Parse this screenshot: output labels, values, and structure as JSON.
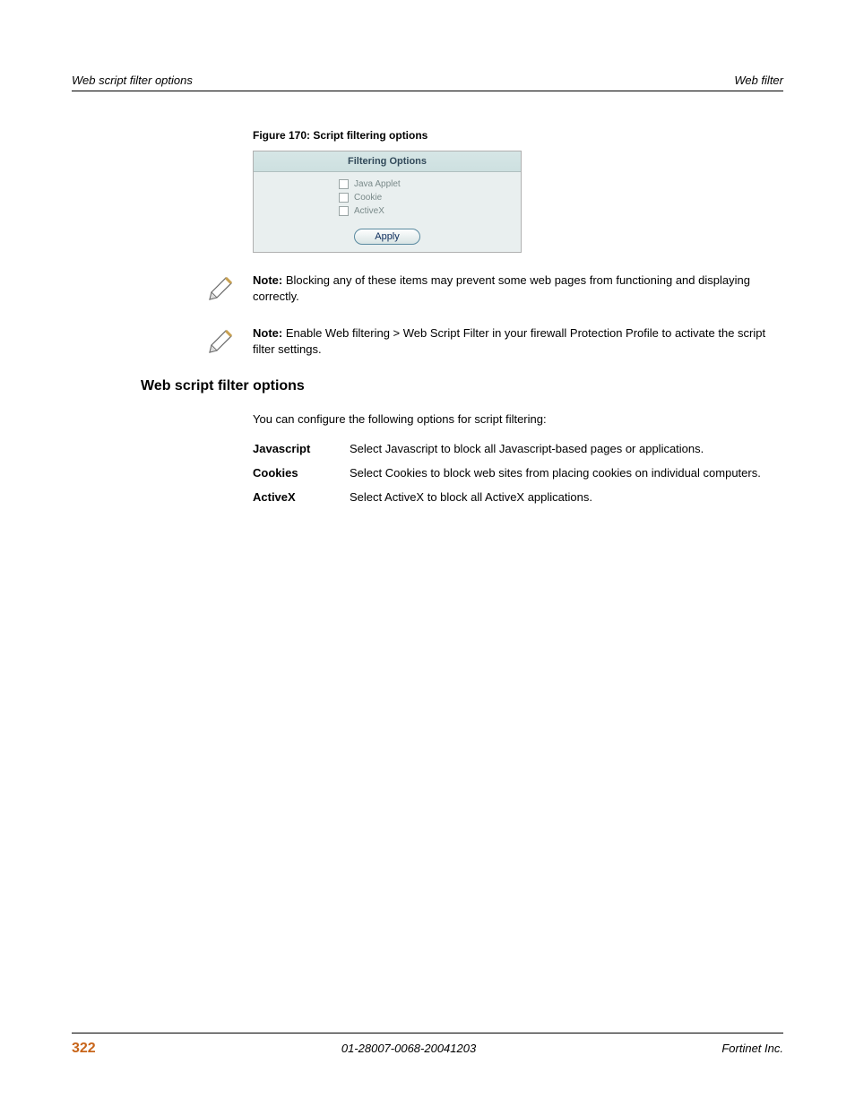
{
  "header": {
    "left": "Web script filter options",
    "right": "Web filter"
  },
  "figure_caption": "Figure 170: Script filtering options",
  "screenshot": {
    "title": "Filtering Options",
    "options": [
      "Java Applet",
      "Cookie",
      "ActiveX"
    ],
    "apply": "Apply"
  },
  "notes": [
    {
      "label": "Note:",
      "text": " Blocking any of these items may prevent some web pages from functioning and displaying correctly."
    },
    {
      "label": "Note:",
      "text": " Enable Web filtering > Web Script Filter in your firewall Protection Profile to activate the script filter settings."
    }
  ],
  "section_heading": "Web script filter options",
  "intro": "You can configure the following options for script filtering:",
  "options_table": [
    {
      "term": "Javascript",
      "def": "Select Javascript to block all Javascript-based pages or applications."
    },
    {
      "term": "Cookies",
      "def": "Select Cookies to block web sites from placing cookies on individual computers."
    },
    {
      "term": "ActiveX",
      "def": "Select ActiveX to block all ActiveX applications."
    }
  ],
  "footer": {
    "page": "322",
    "docid": "01-28007-0068-20041203",
    "company": "Fortinet Inc."
  }
}
